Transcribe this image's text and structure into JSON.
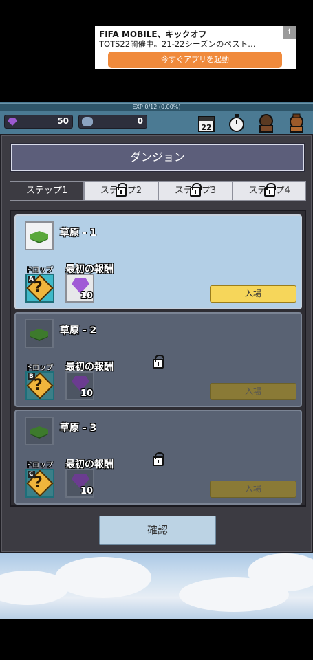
{
  "ad": {
    "title": "FIFA MOBILE、キックオフ",
    "subtitle": "TOTS22開催中。21-22シーズンのベスト…",
    "cta": "今すぐアプリを起動",
    "info": "i"
  },
  "hud": {
    "exp_text": "EXP 0/12 (0.00%)",
    "gems": "50",
    "stones": "0",
    "calendar_day": "22"
  },
  "dialog": {
    "title": "ダンジョン",
    "tabs": [
      {
        "label": "ステップ1",
        "locked": false
      },
      {
        "label": "ステップ2",
        "locked": true
      },
      {
        "label": "ステップ3",
        "locked": true
      },
      {
        "label": "ステップ4",
        "locked": true
      }
    ],
    "stages": [
      {
        "name": "草原 - 1",
        "drop_label": "ドロップ",
        "drop_grade": "A",
        "reward_label": "最初の報酬",
        "reward_count": "10",
        "enter_label": "入場",
        "locked": false
      },
      {
        "name": "草原 - 2",
        "drop_label": "ドロップ",
        "drop_grade": "B",
        "reward_label": "最初の報酬",
        "reward_count": "10",
        "enter_label": "入場",
        "locked": true
      },
      {
        "name": "草原 - 3",
        "drop_label": "ドロップ",
        "drop_grade": "C",
        "reward_label": "最初の報酬",
        "reward_count": "10",
        "enter_label": "入場",
        "locked": true
      }
    ],
    "confirm_label": "確認"
  },
  "colors": {
    "accent_enter": "#f6d65a",
    "unlocked_card": "#b3cfe6",
    "locked_card": "#596273",
    "gem": "#a05ad6"
  }
}
